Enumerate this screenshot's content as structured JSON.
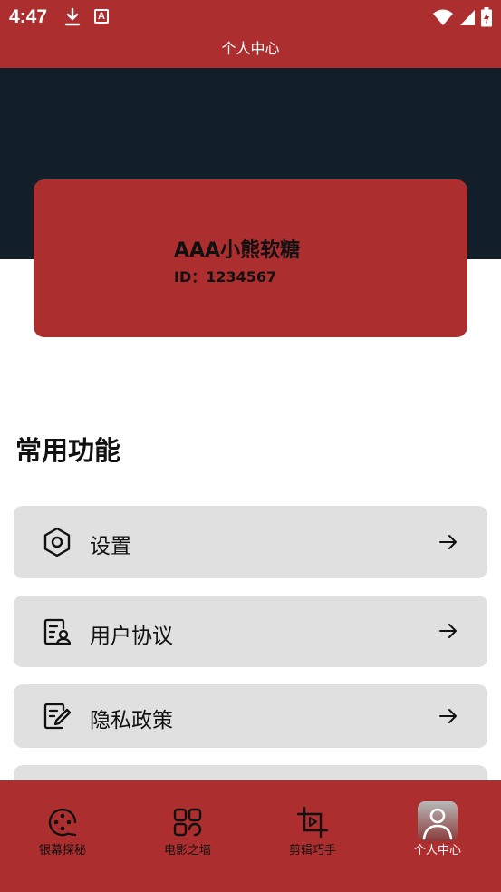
{
  "status": {
    "time": "4:47",
    "notification_letter": "A"
  },
  "appbar": {
    "title": "个人中心"
  },
  "profile": {
    "name": "AAA小熊软糖",
    "id_text": "ID：1234567"
  },
  "section": {
    "title": "常用功能"
  },
  "menu": [
    {
      "label": "设置",
      "icon": "hexagon-settings-icon"
    },
    {
      "label": "用户协议",
      "icon": "user-agreement-icon"
    },
    {
      "label": "隐私政策",
      "icon": "privacy-policy-icon"
    }
  ],
  "nav": [
    {
      "label": "银幕探秘",
      "icon": "film-reel-icon"
    },
    {
      "label": "电影之墙",
      "icon": "grid-icon"
    },
    {
      "label": "剪辑巧手",
      "icon": "crop-play-icon"
    },
    {
      "label": "个人中心",
      "icon": "person-icon",
      "active": true
    }
  ],
  "colors": {
    "primary": "#ad2e2e",
    "hero": "#121e28",
    "menu_bg": "#e0e0e0"
  }
}
